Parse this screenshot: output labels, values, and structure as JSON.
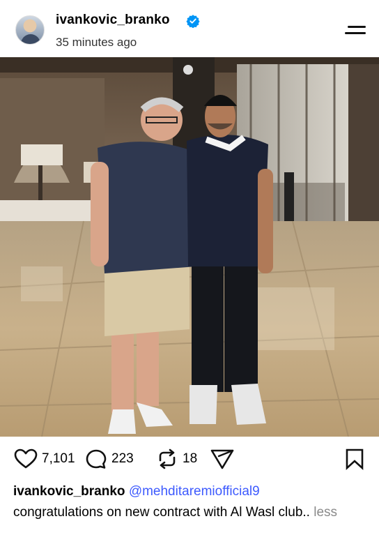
{
  "post": {
    "username": "ivankovic_branko",
    "timestamp": "35 minutes ago",
    "verified": true,
    "accent_color": "#0095f6"
  },
  "icons": {
    "avatar": "profile-avatar",
    "verified": "verified-badge-icon",
    "menu": "menu-icon",
    "like": "heart-icon",
    "comment": "comment-icon",
    "repost": "repost-icon",
    "share": "share-icon",
    "bookmark": "bookmark-icon"
  },
  "stats": {
    "likes": "7,101",
    "comments": "223",
    "reposts": "18"
  },
  "caption": {
    "username": "ivankovic_branko",
    "mention": "@mehditaremiofficial9",
    "text": "congratulations on new contract with Al Wasl club..",
    "more_toggle": "less",
    "mention_color": "#3d5afe"
  }
}
